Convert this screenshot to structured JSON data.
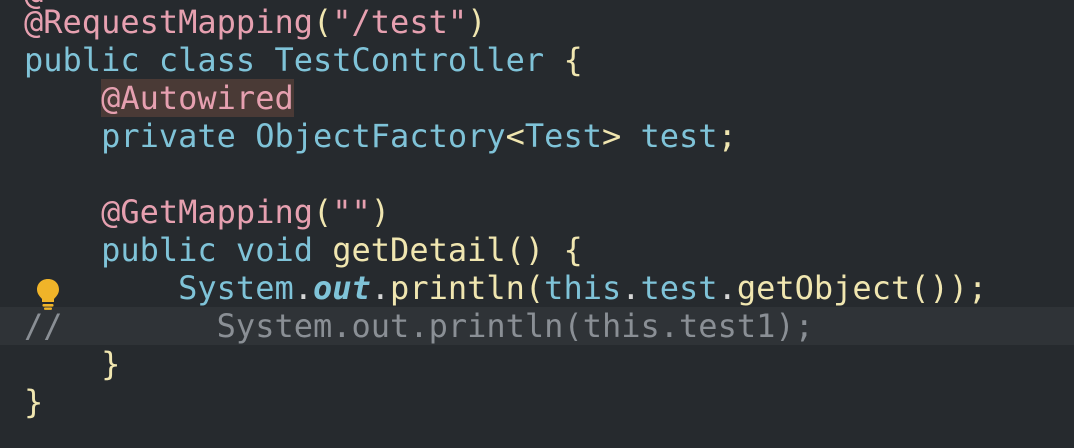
{
  "editor": {
    "top_fragment": "@",
    "lines": [
      {
        "tokens": [
          {
            "t": "@RequestMapping",
            "c": "annot"
          },
          {
            "t": "(",
            "c": "punct"
          },
          {
            "t": "\"/test\"",
            "c": "str"
          },
          {
            "t": ")",
            "c": "punct"
          }
        ]
      },
      {
        "tokens": [
          {
            "t": "public",
            "c": "kw"
          },
          {
            "t": " ",
            "c": "plain"
          },
          {
            "t": "class",
            "c": "kw"
          },
          {
            "t": " ",
            "c": "plain"
          },
          {
            "t": "TestController",
            "c": "type"
          },
          {
            "t": " ",
            "c": "plain"
          },
          {
            "t": "{",
            "c": "punct"
          }
        ]
      },
      {
        "tokens": [
          {
            "t": "    ",
            "c": "plain"
          },
          {
            "t": "@Autowired",
            "c": "annot-hl"
          }
        ]
      },
      {
        "tokens": [
          {
            "t": "    ",
            "c": "plain"
          },
          {
            "t": "private",
            "c": "kw"
          },
          {
            "t": " ",
            "c": "plain"
          },
          {
            "t": "ObjectFactory",
            "c": "type"
          },
          {
            "t": "<",
            "c": "punct"
          },
          {
            "t": "Test",
            "c": "type"
          },
          {
            "t": ">",
            "c": "punct"
          },
          {
            "t": " ",
            "c": "plain"
          },
          {
            "t": "test",
            "c": "field"
          },
          {
            "t": ";",
            "c": "punct"
          }
        ]
      },
      {
        "tokens": []
      },
      {
        "tokens": [
          {
            "t": "    ",
            "c": "plain"
          },
          {
            "t": "@GetMapping",
            "c": "annot"
          },
          {
            "t": "(",
            "c": "punct"
          },
          {
            "t": "\"\"",
            "c": "str"
          },
          {
            "t": ")",
            "c": "punct"
          }
        ]
      },
      {
        "tokens": [
          {
            "t": "    ",
            "c": "plain"
          },
          {
            "t": "public",
            "c": "kw"
          },
          {
            "t": " ",
            "c": "plain"
          },
          {
            "t": "void",
            "c": "kw"
          },
          {
            "t": " ",
            "c": "plain"
          },
          {
            "t": "getDetail",
            "c": "method"
          },
          {
            "t": "()",
            "c": "punct"
          },
          {
            "t": " ",
            "c": "plain"
          },
          {
            "t": "{",
            "c": "punct"
          }
        ]
      },
      {
        "tokens": [
          {
            "t": "        ",
            "c": "plain"
          },
          {
            "t": "System",
            "c": "type"
          },
          {
            "t": ".",
            "c": "plain"
          },
          {
            "t": "out",
            "c": "static"
          },
          {
            "t": ".",
            "c": "plain"
          },
          {
            "t": "println",
            "c": "method"
          },
          {
            "t": "(",
            "c": "punct"
          },
          {
            "t": "this",
            "c": "kw"
          },
          {
            "t": ".",
            "c": "plain"
          },
          {
            "t": "test",
            "c": "field"
          },
          {
            "t": ".",
            "c": "plain"
          },
          {
            "t": "getObject",
            "c": "method"
          },
          {
            "t": "());",
            "c": "punct"
          }
        ]
      },
      {
        "current": true,
        "tokens": [
          {
            "t": "//        System.out.println(this.test1);",
            "c": "comment"
          }
        ]
      },
      {
        "tokens": [
          {
            "t": "    ",
            "c": "plain"
          },
          {
            "t": "}",
            "c": "punct"
          }
        ]
      },
      {
        "tokens": [
          {
            "t": "}",
            "c": "punct"
          }
        ]
      }
    ],
    "gutter": {
      "icon": "lightbulb-icon",
      "color": "#f0b429"
    }
  }
}
